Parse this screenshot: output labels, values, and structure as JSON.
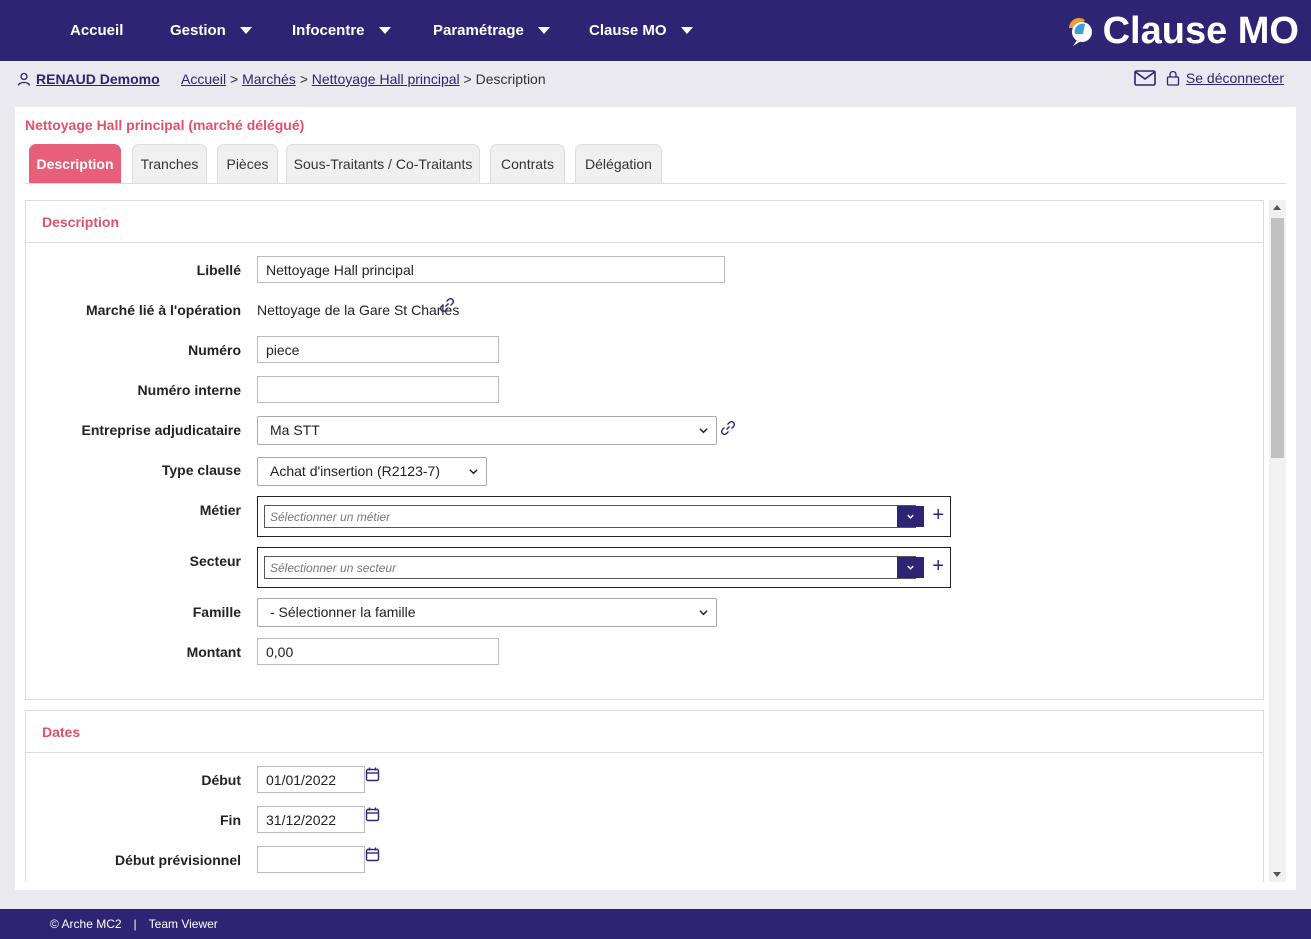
{
  "nav": {
    "items": [
      {
        "label": "Accueil",
        "has_menu": false
      },
      {
        "label": "Gestion",
        "has_menu": true
      },
      {
        "label": "Infocentre",
        "has_menu": true
      },
      {
        "label": "Paramétrage",
        "has_menu": true
      },
      {
        "label": "Clause MO",
        "has_menu": true
      }
    ],
    "logo_text": "Clause MO"
  },
  "subbar": {
    "user_name": "RENAUD Demomo",
    "breadcrumb": [
      "Accueil",
      "Marchés",
      "Nettoyage Hall principal",
      "Description"
    ],
    "sep": ">",
    "logout_label": "Se déconnecter"
  },
  "page": {
    "title": "Nettoyage Hall principal (marché délégué)",
    "tabs": [
      "Description",
      "Tranches",
      "Pièces",
      "Sous-Traitants / Co-Traitants",
      "Contrats",
      "Délégation"
    ],
    "active_tab": "Description"
  },
  "description": {
    "heading": "Description",
    "fields": {
      "libelle": {
        "label": "Libellé",
        "value": "Nettoyage Hall principal"
      },
      "marche_lie": {
        "label": "Marché lié à l'opération",
        "value": "Nettoyage de la Gare St Charles"
      },
      "numero": {
        "label": "Numéro",
        "value": "piece"
      },
      "numero_interne": {
        "label": "Numéro interne",
        "value": ""
      },
      "entreprise": {
        "label": "Entreprise adjudicataire",
        "value": "Ma STT"
      },
      "type_clause": {
        "label": "Type clause",
        "value": "Achat d'insertion (R2123-7)"
      },
      "metier": {
        "label": "Métier",
        "placeholder": "Sélectionner un métier"
      },
      "secteur": {
        "label": "Secteur",
        "placeholder": "Sélectionner un secteur"
      },
      "famille": {
        "label": "Famille",
        "value": "- Sélectionner la famille"
      },
      "montant": {
        "label": "Montant",
        "value": "0,00"
      }
    }
  },
  "dates": {
    "heading": "Dates",
    "fields": {
      "debut": {
        "label": "Début",
        "value": "01/01/2022"
      },
      "fin": {
        "label": "Fin",
        "value": "31/12/2022"
      },
      "debut_prev": {
        "label": "Début prévisionnel",
        "value": ""
      }
    }
  },
  "footer": {
    "copyright": "© Arche MC2",
    "sep": "|",
    "link": "Team Viewer"
  },
  "colors": {
    "primary": "#2e2474",
    "accent": "#e2506c",
    "tab_active": "#e85f7a"
  }
}
